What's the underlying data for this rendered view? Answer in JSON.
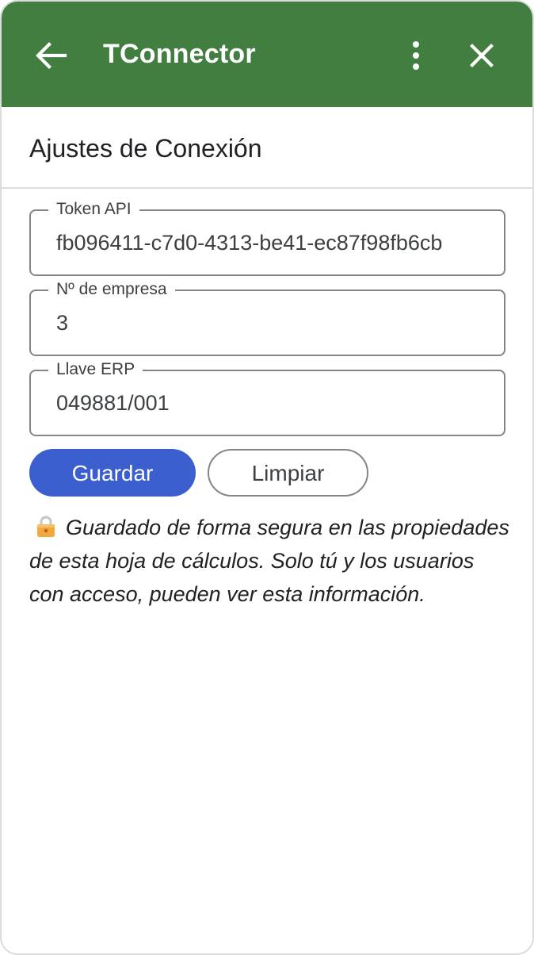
{
  "header": {
    "title": "TConnector",
    "bg_color": "#437e41",
    "back_icon": "arrow-left-icon",
    "more_icon": "more-vert-icon",
    "close_icon": "close-icon"
  },
  "section": {
    "title": "Ajustes de Conexión"
  },
  "form": {
    "fields": [
      {
        "label": "Token API",
        "value": "fb096411-c7d0-4313-be41-ec87f98fb6cb"
      },
      {
        "label": "Nº de empresa",
        "value": "3"
      },
      {
        "label": "Llave ERP",
        "value": "049881/001"
      }
    ]
  },
  "actions": {
    "save_label": "Guardar",
    "clear_label": "Limpiar",
    "primary_color": "#3b5fcf"
  },
  "note": {
    "icon": "lock-icon",
    "text": "Guardado de forma segura en las propiedades de esta hoja de cálculos. Solo tú y los usuarios con acceso, pueden ver esta información."
  }
}
